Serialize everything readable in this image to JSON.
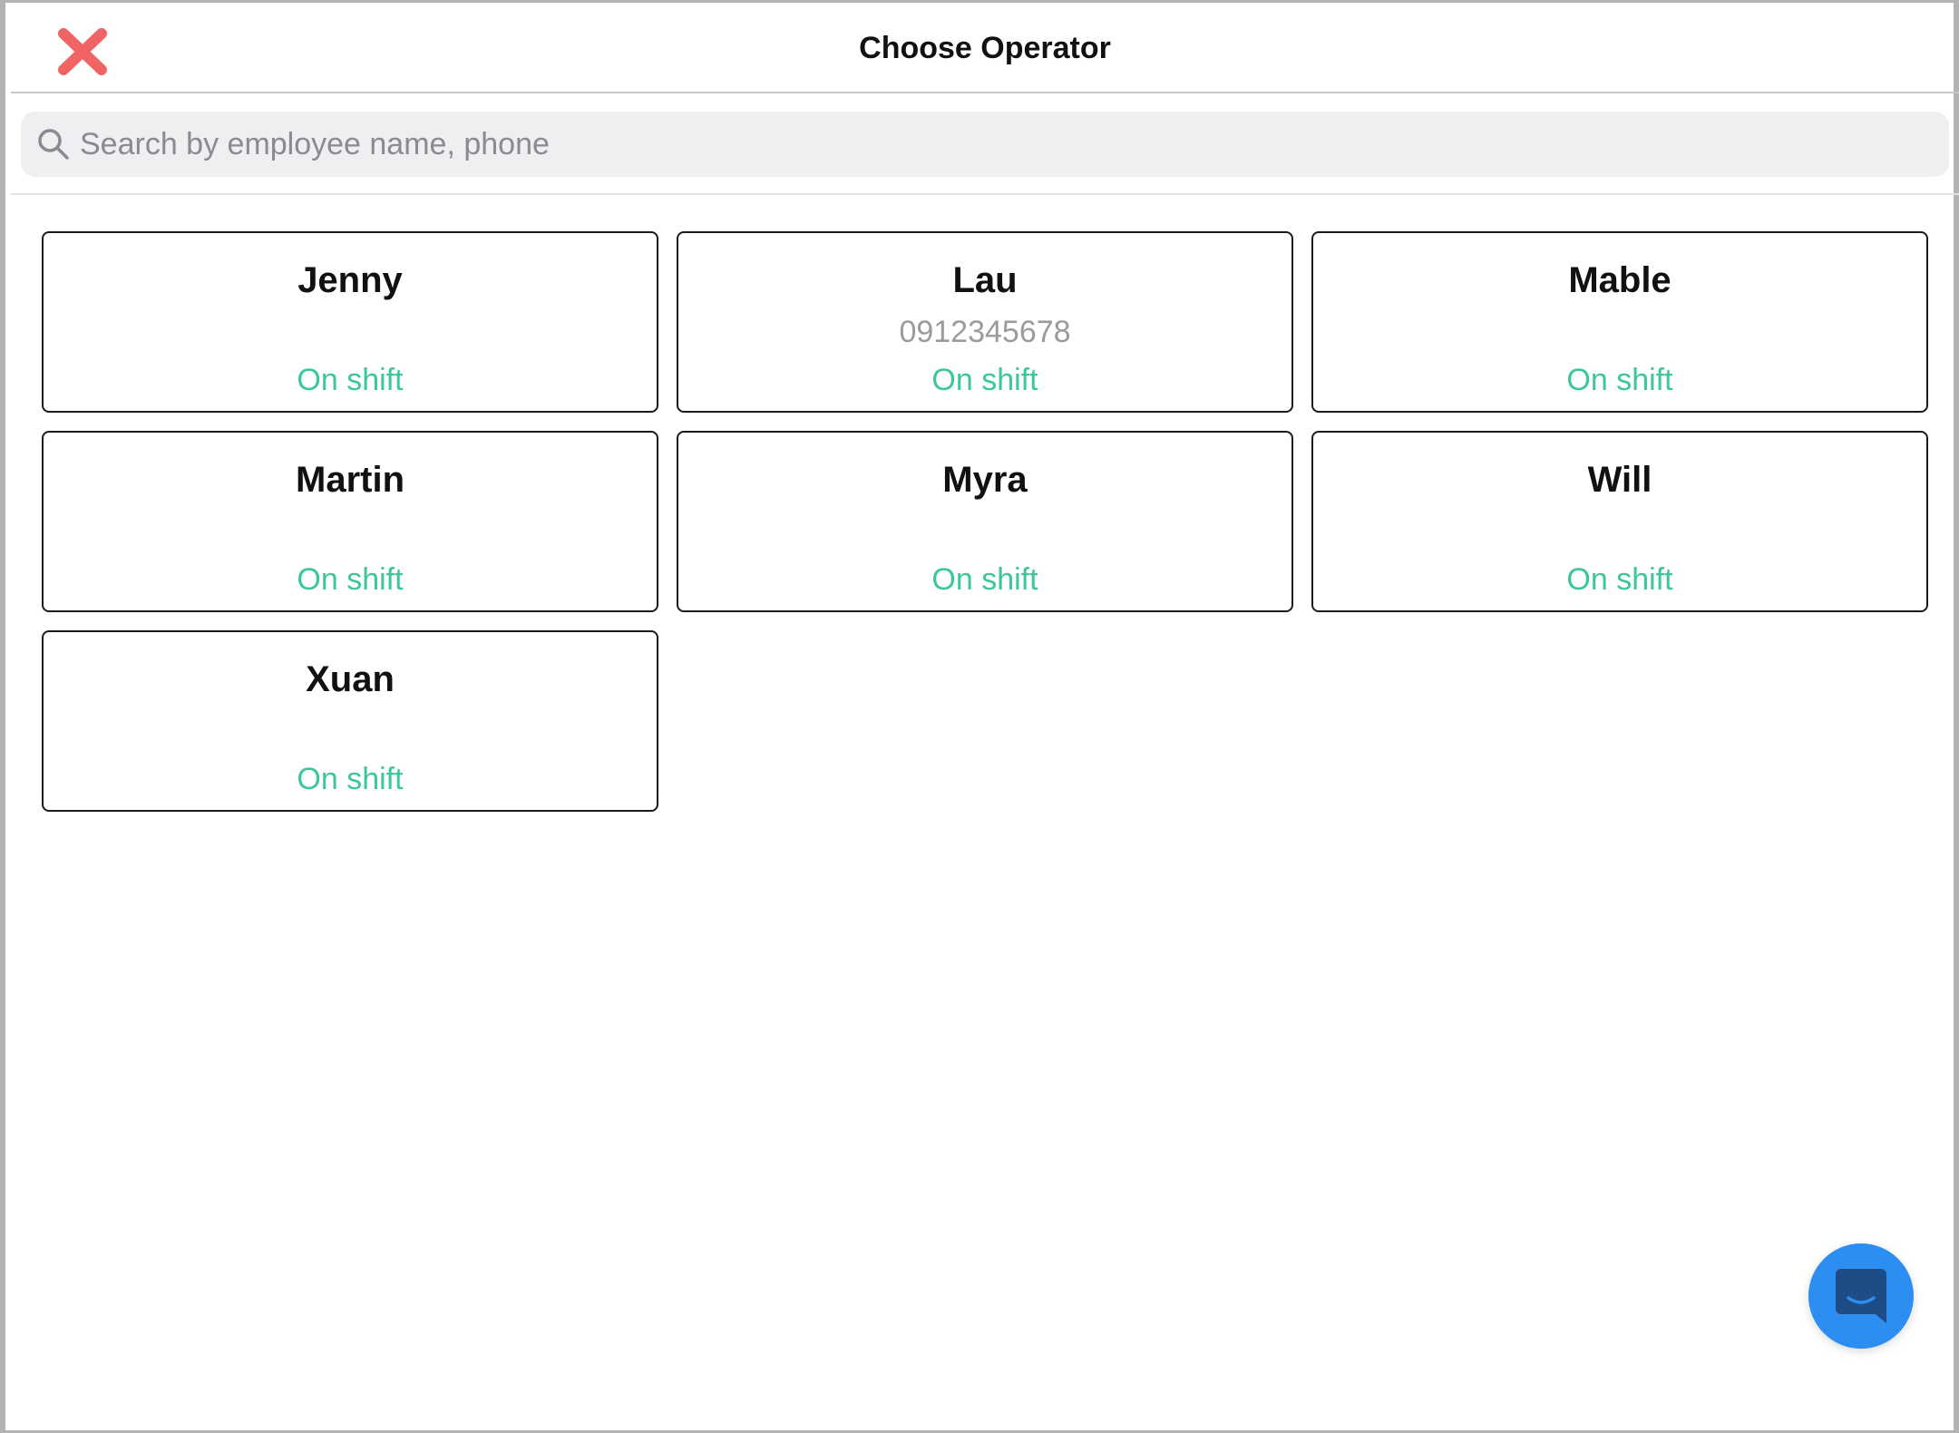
{
  "header": {
    "title": "Choose Operator"
  },
  "search": {
    "placeholder": "Search by employee name, phone",
    "value": ""
  },
  "operators": [
    {
      "name": "Jenny",
      "phone": "",
      "status": "On shift"
    },
    {
      "name": "Lau",
      "phone": "0912345678",
      "status": "On shift"
    },
    {
      "name": "Mable",
      "phone": "",
      "status": "On shift"
    },
    {
      "name": "Martin",
      "phone": "",
      "status": "On shift"
    },
    {
      "name": "Myra",
      "phone": "",
      "status": "On shift"
    },
    {
      "name": "Will",
      "phone": "",
      "status": "On shift"
    },
    {
      "name": "Xuan",
      "phone": "",
      "status": "On shift"
    }
  ],
  "colors": {
    "close": "#f06464",
    "status": "#3cc79b",
    "chat": "#2b8ef0",
    "chat_icon": "#1e4c86"
  },
  "icons": {
    "close": "close-icon",
    "search": "search-icon",
    "chat": "chat-icon"
  }
}
